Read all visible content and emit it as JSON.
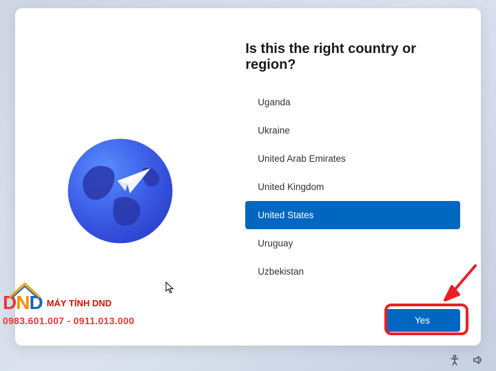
{
  "heading": "Is this the right country or region?",
  "countries": {
    "items": [
      "Uganda",
      "Ukraine",
      "United Arab Emirates",
      "United Kingdom",
      "United States",
      "Uruguay",
      "Uzbekistan"
    ],
    "selected_index": 4
  },
  "yes_label": "Yes",
  "watermark": {
    "logo_text_1": "D",
    "logo_text_2": "N",
    "logo_text_3": "D",
    "title": "MÁY TÍNH DND",
    "phones": "0983.601.007 - 0911.013.000"
  },
  "colors": {
    "accent": "#0067c0",
    "annotation": "#ee1c25"
  }
}
